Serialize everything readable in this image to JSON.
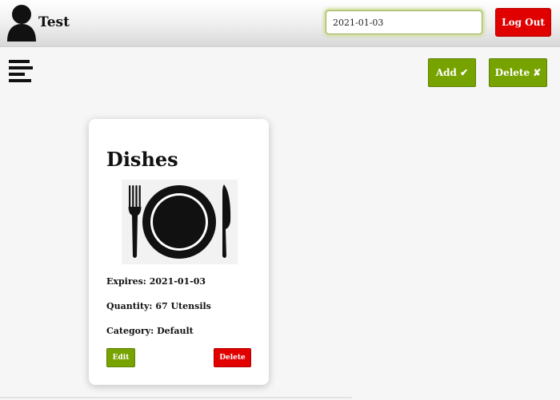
{
  "header": {
    "username": "Test",
    "date_value": "2021-01-03",
    "logout_label": "Log Out"
  },
  "toolbar": {
    "add_label": "Add ✔",
    "delete_label": "Delete ✘"
  },
  "items": [
    {
      "name": "Dishes",
      "image_icon": "plate-with-fork-and-knife",
      "expires": "Expires: 2021-01-03",
      "quantity": "Quantity: 67 Utensils",
      "category": "Category: Default",
      "edit_label": "Edit",
      "delete_label": "Delete"
    }
  ],
  "colors": {
    "accent_green": "#77a300",
    "danger_red": "#e00000",
    "header_gradient_top": "#ffffff",
    "header_gradient_bottom": "#d8d8d8"
  }
}
